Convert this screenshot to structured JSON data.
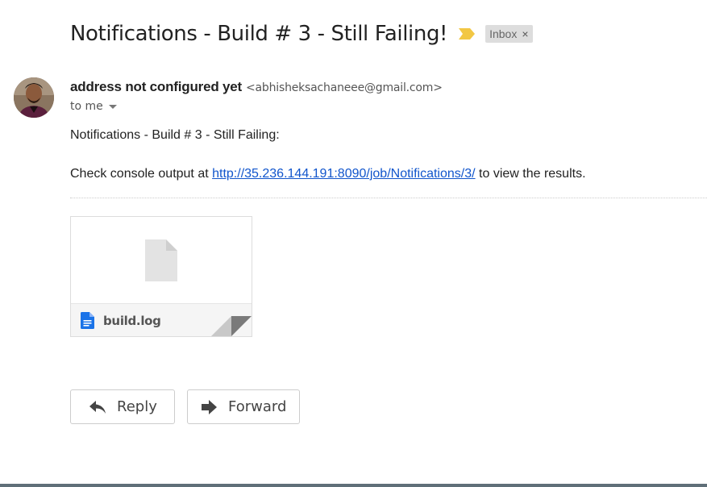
{
  "email": {
    "subject": "Notifications - Build # 3 - Still Failing!",
    "label": "Inbox",
    "label_remove": "×",
    "sender_name": "address not configured yet",
    "sender_email": "<abhisheksachaneee@gmail.com>",
    "recipient": "to me",
    "body_line1": "Notifications - Build # 3 - Still Failing:",
    "body_line2_prefix": "Check console output at ",
    "body_link": "http://35.236.144.191:8090/job/Notifications/3/",
    "body_line2_suffix": " to view the results."
  },
  "attachment": {
    "file_name": "build.log"
  },
  "actions": {
    "reply_label": "Reply",
    "forward_label": "Forward"
  },
  "colors": {
    "link": "#1155cc",
    "importance_marker": "#f2c744",
    "file_icon": "#1a73e8",
    "label_chip_bg": "#dddddd"
  },
  "icons": {
    "importance": "importance-marker-icon",
    "remove_label": "close-icon",
    "recipient_details": "chevron-down-icon",
    "attachment_preview": "document-icon",
    "attachment_type": "file-icon",
    "reply": "reply-arrow-icon",
    "forward": "forward-arrow-icon"
  }
}
